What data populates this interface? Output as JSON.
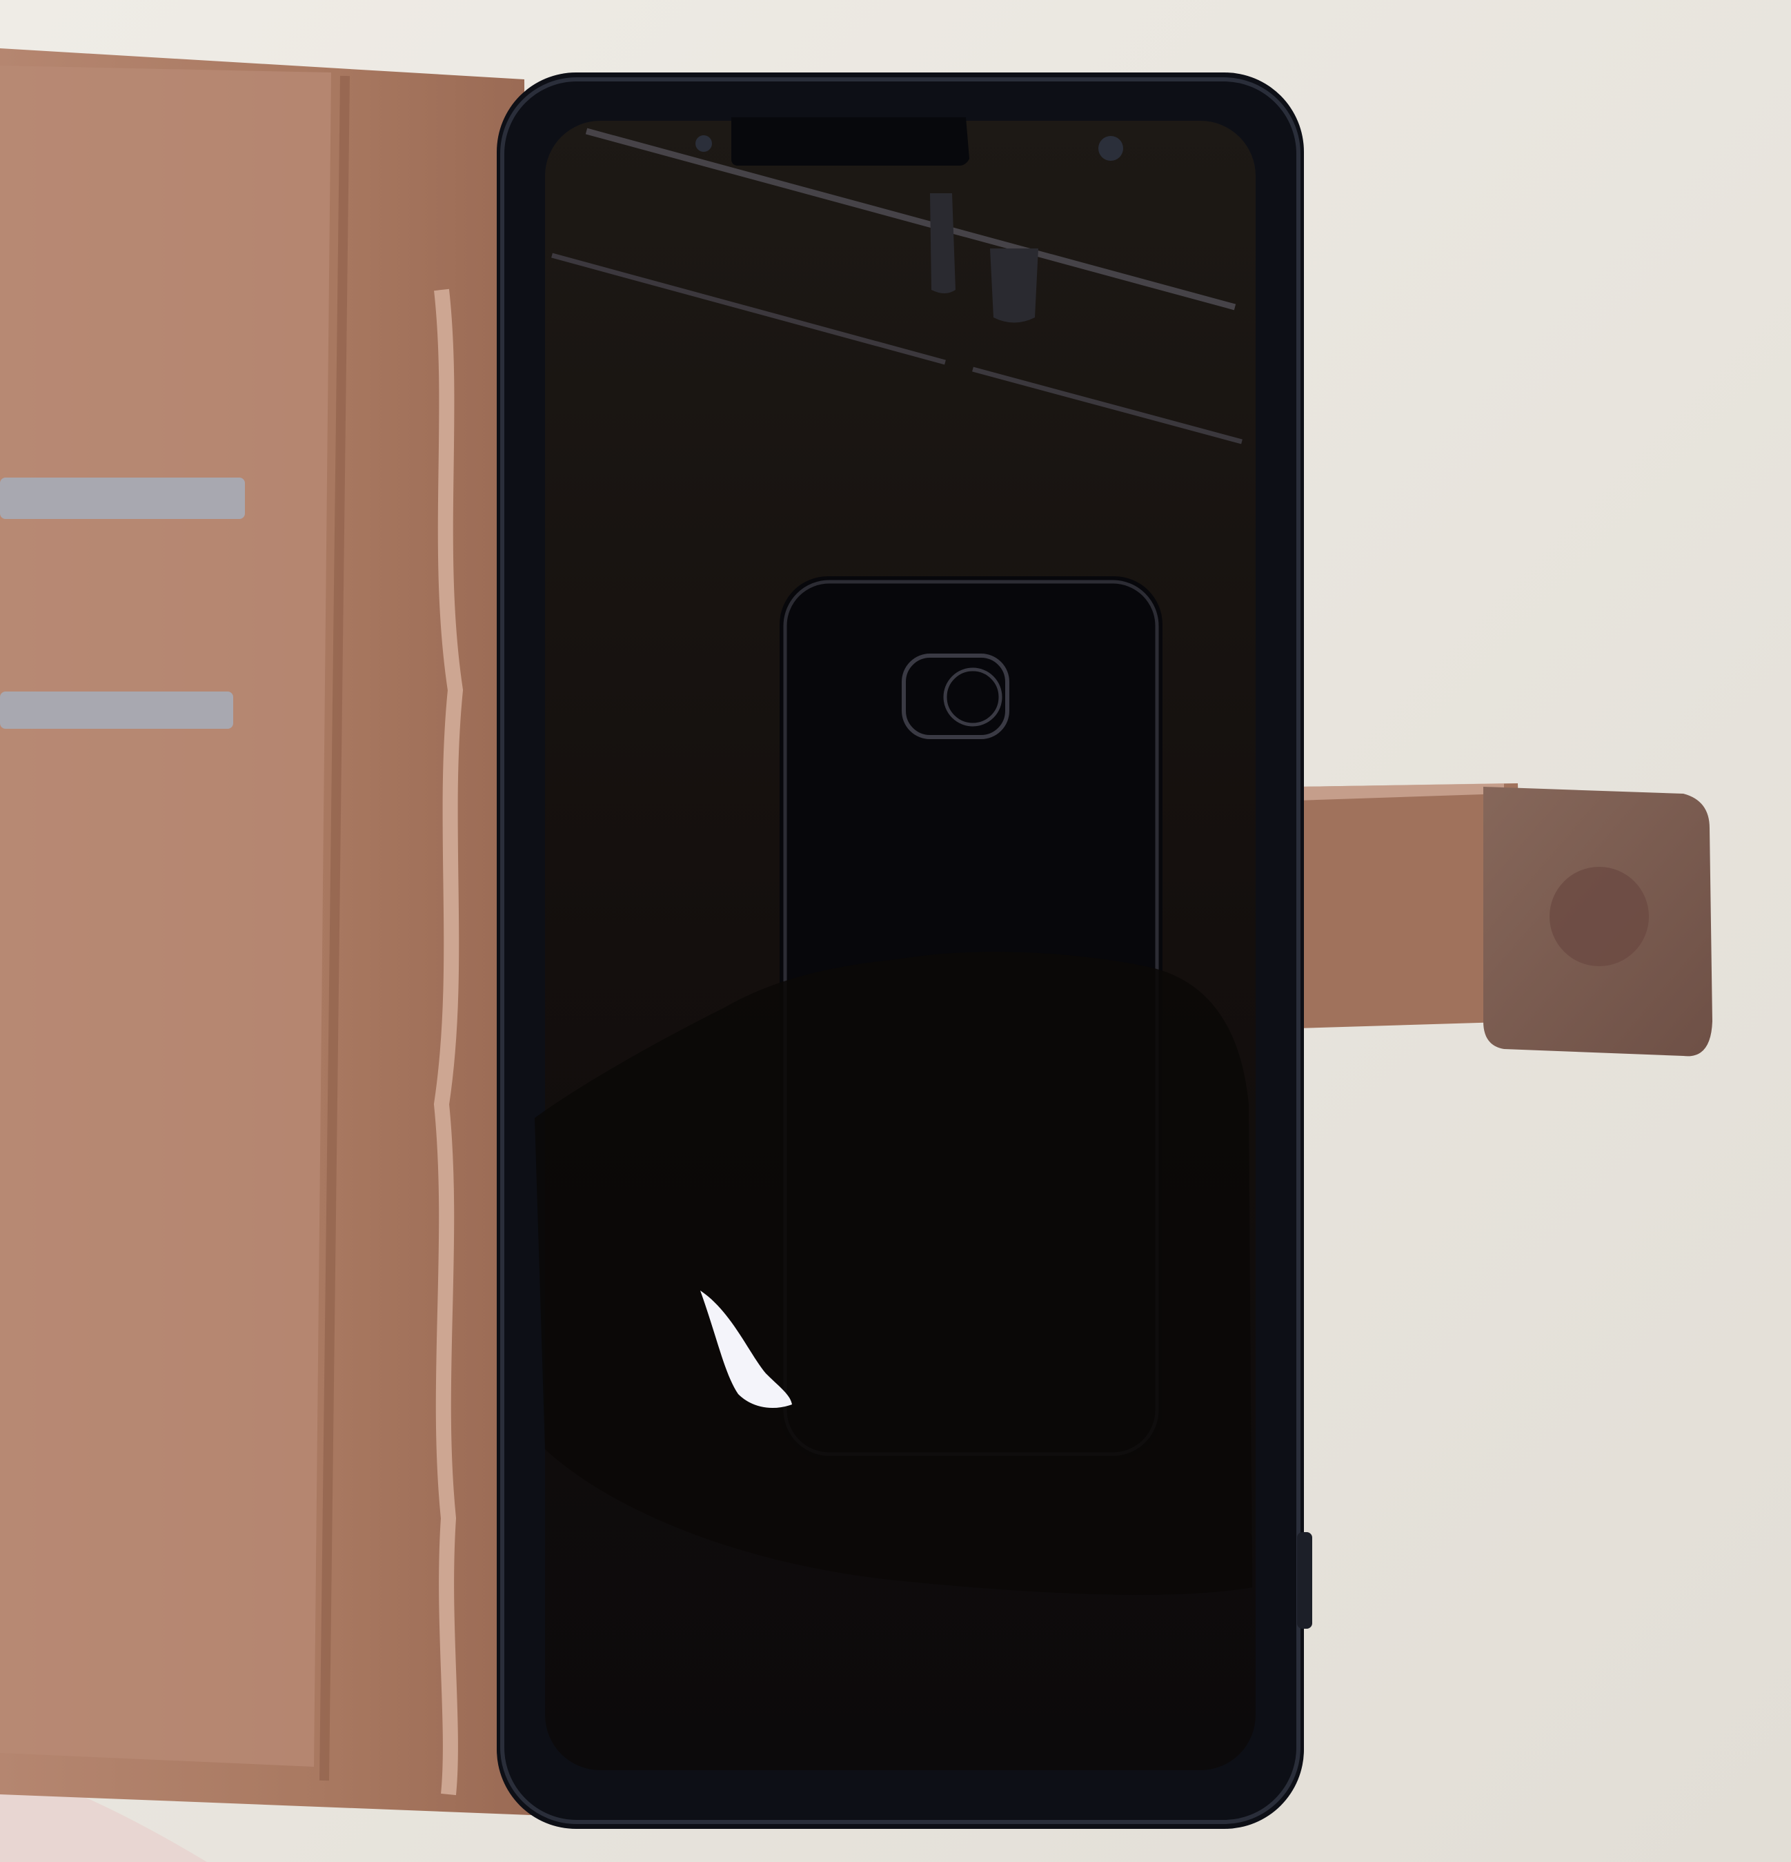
{
  "scene": {
    "subject": "smartphone-in-wallet-case",
    "screen_state": "off",
    "case_material": "leather",
    "colors": {
      "table": "#e9e6df",
      "leather": "#b08068",
      "leather_dark": "#8d5f4a",
      "leather_worn": "#dcb8a6",
      "phone_body": "#0d0f16",
      "screen": "#16120f",
      "card_slot": "#a8a8b0",
      "clasp": "#7a5c50",
      "reflection_highlight": "#f4f4fa"
    }
  }
}
